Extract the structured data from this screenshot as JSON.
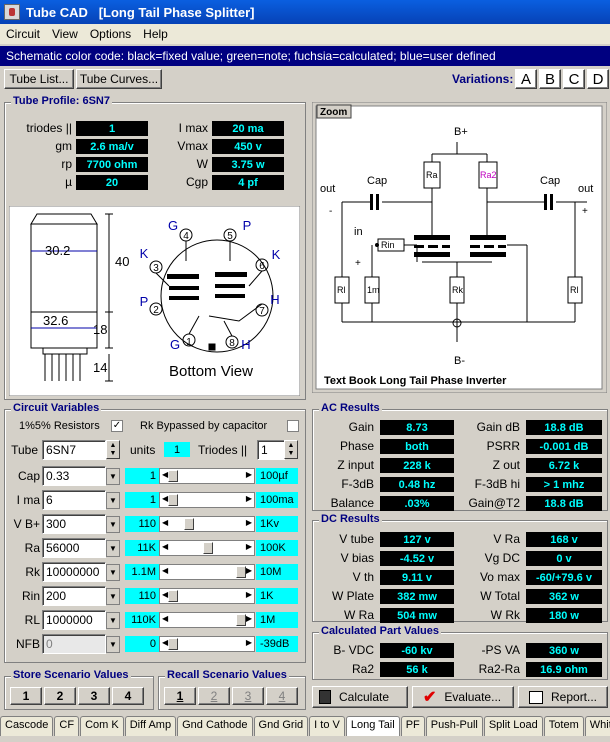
{
  "window": {
    "title": "Tube CAD   [Long Tail Phase Splitter]"
  },
  "menu": [
    "Circuit",
    "View",
    "Options",
    "Help"
  ],
  "color_code": "Schematic color code: black=fixed value; green=note; fuchsia=calculated; blue=user defined",
  "toolbar": {
    "tube_list": "Tube List...",
    "tube_curves": "Tube Curves...",
    "variations_label": "Variations:",
    "variations": [
      "A",
      "B",
      "C",
      "D"
    ]
  },
  "tube_profile": {
    "title": "Tube Profile: 6SN7",
    "left": [
      {
        "label": "triodes ||",
        "value": "1"
      },
      {
        "label": "gm",
        "value": "2.6 ma/v"
      },
      {
        "label": "rp",
        "value": "7700 ohm"
      },
      {
        "label": "µ",
        "value": "20"
      }
    ],
    "right": [
      {
        "label": "I max",
        "value": "20 ma"
      },
      {
        "label": "Vmax",
        "value": "450 v"
      },
      {
        "label": "W",
        "value": "3.75 w"
      },
      {
        "label": "Cgp",
        "value": "4 pf"
      }
    ]
  },
  "drawing": {
    "dims": [
      "30.2",
      "40",
      "32.6",
      "18",
      "14"
    ],
    "pins": [
      "1",
      "2",
      "3",
      "4",
      "5",
      "6",
      "7",
      "8"
    ],
    "pin_labels": [
      "G",
      "P",
      "K",
      "G",
      "P",
      "K",
      "H",
      "H"
    ],
    "caption": "Bottom View"
  },
  "schematic": {
    "zoom": "Zoom",
    "caption": "Text Book Long Tail Phase Inverter",
    "labels": {
      "bplus": "B+",
      "bminus": "B-",
      "cap1": "Cap",
      "cap2": "Cap",
      "out1": "out",
      "out2": "out",
      "in": "in",
      "rin": "Rin",
      "ra": "Ra",
      "ra2": "Ra2",
      "rl1": "Rl",
      "rl2": "Rl",
      "r1m": "1m",
      "rk": "Rk",
      "minus1": "-",
      "plus1": "+",
      "plus2": "+",
      "minus2": "-"
    }
  },
  "circuit_vars": {
    "title": "Circuit Variables",
    "resistors_label": "1%5% Resistors",
    "rk_bypass_label": "Rk Bypassed by capacitor",
    "tube_label": "Tube",
    "tube_value": "6SN7",
    "units_label": "units",
    "units_value": "1",
    "triodes_label": "Triodes ||",
    "triodes_value": "1",
    "rows": [
      {
        "label": "Cap",
        "value": "0.33",
        "slider": "1",
        "max": "100µf",
        "pos": 0.05
      },
      {
        "label": "I ma",
        "value": "6",
        "slider": "1",
        "max": "100ma",
        "pos": 0.05
      },
      {
        "label": "V B+",
        "value": "300",
        "slider": "110",
        "max": "1Kv",
        "pos": 0.25
      },
      {
        "label": "Ra",
        "value": "56000",
        "slider": "11K",
        "max": "100K",
        "pos": 0.5
      },
      {
        "label": "Rk",
        "value": "10000000",
        "slider": "1.1M",
        "max": "10M",
        "pos": 0.92
      },
      {
        "label": "Rin",
        "value": "200",
        "slider": "110",
        "max": "1K",
        "pos": 0.05
      },
      {
        "label": "RL",
        "value": "1000000",
        "slider": "110K",
        "max": "1M",
        "pos": 0.92
      },
      {
        "label": "NFB",
        "value": "0",
        "slider": "0",
        "max": "-39dB",
        "pos": 0.05
      }
    ]
  },
  "ac_results": {
    "title": "AC Results",
    "left": [
      {
        "label": "Gain",
        "value": "8.73"
      },
      {
        "label": "Phase",
        "value": "both"
      },
      {
        "label": "Z input",
        "value": "228 k"
      },
      {
        "label": "F-3dB",
        "value": "0.48 hz"
      },
      {
        "label": "Balance",
        "value": ".03%"
      }
    ],
    "right": [
      {
        "label": "Gain dB",
        "value": "18.8 dB"
      },
      {
        "label": "PSRR",
        "value": "-0.001 dB"
      },
      {
        "label": "Z out",
        "value": "6.72 k"
      },
      {
        "label": "F-3dB hi",
        "value": "> 1 mhz"
      },
      {
        "label": "Gain@T2",
        "value": "18.8 dB"
      }
    ]
  },
  "dc_results": {
    "title": "DC Results",
    "left": [
      {
        "label": "V tube",
        "value": "127 v"
      },
      {
        "label": "V bias",
        "value": "-4.52 v"
      },
      {
        "label": "V th",
        "value": "9.11 v"
      },
      {
        "label": "W Plate",
        "value": "382 mw"
      },
      {
        "label": "W Ra",
        "value": "504 mw"
      }
    ],
    "right": [
      {
        "label": "V Ra",
        "value": "168 v"
      },
      {
        "label": "Vg DC",
        "value": "0 v"
      },
      {
        "label": "Vo max",
        "value": "-60/+79.6 v"
      },
      {
        "label": "W Total",
        "value": "362 w"
      },
      {
        "label": "W Rk",
        "value": "180 w"
      }
    ]
  },
  "calc_parts": {
    "title": "Calculated Part Values",
    "left": [
      {
        "label": "B- VDC",
        "value": "-60 kv"
      },
      {
        "label": "Ra2",
        "value": "56 k"
      }
    ],
    "right": [
      {
        "label": "-PS VA",
        "value": "360 w"
      },
      {
        "label": "Ra2-Ra",
        "value": "16.9 ohm"
      }
    ]
  },
  "store": {
    "title": "Store Scenario Values",
    "buttons": [
      "1",
      "2",
      "3",
      "4"
    ]
  },
  "recall": {
    "title": "Recall Scenario Values",
    "buttons": [
      "1",
      "2",
      "3",
      "4"
    ]
  },
  "actions": {
    "calculate": "Calculate",
    "evaluate": "Evaluate...",
    "report": "Report..."
  },
  "tabs": [
    "Cascode",
    "CF",
    "Com K",
    "Diff Amp",
    "Gnd Cathode",
    "Gnd Grid",
    "I to V",
    "Long Tail",
    "PF",
    "Push-Pull",
    "Split Load",
    "Totem",
    "White Cf"
  ],
  "active_tab": "Long Tail"
}
